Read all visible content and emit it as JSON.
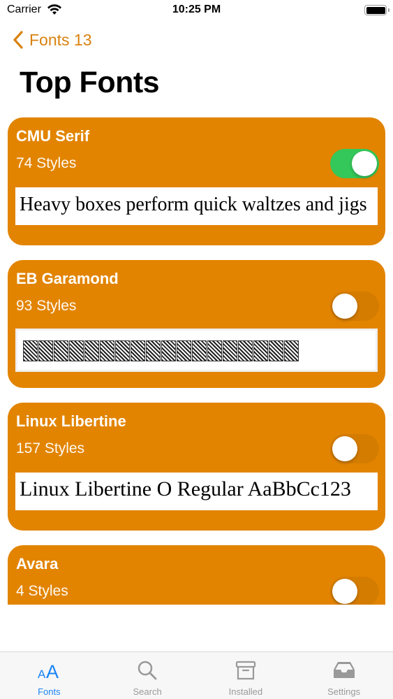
{
  "status_bar": {
    "carrier": "Carrier",
    "time": "10:25 PM"
  },
  "nav": {
    "back_label": "Fonts 13"
  },
  "page": {
    "title": "Top Fonts"
  },
  "colors": {
    "accent": "#d9820f",
    "card": "#e28400",
    "toggle_on": "#34c759",
    "tab_active": "#1a84f5"
  },
  "fonts": [
    {
      "name": "CMU Serif",
      "styles": "74 Styles",
      "installed": true,
      "preview": "Heavy boxes perform quick waltzes and jigs"
    },
    {
      "name": "EB Garamond",
      "styles": "93 Styles",
      "installed": false,
      "preview": "AABCDEFGHIJKLMNOPQR"
    },
    {
      "name": "Linux Libertine",
      "styles": "157 Styles",
      "installed": false,
      "preview": "Linux Libertine O Regular AaBbCc123"
    },
    {
      "name": "Avara",
      "styles": "4 Styles",
      "installed": false
    }
  ],
  "tabs": [
    {
      "label": "Fonts",
      "icon": "font-aa-icon",
      "active": true
    },
    {
      "label": "Search",
      "icon": "search-icon",
      "active": false
    },
    {
      "label": "Installed",
      "icon": "archive-box-icon",
      "active": false
    },
    {
      "label": "Settings",
      "icon": "tray-icon",
      "active": false
    }
  ]
}
